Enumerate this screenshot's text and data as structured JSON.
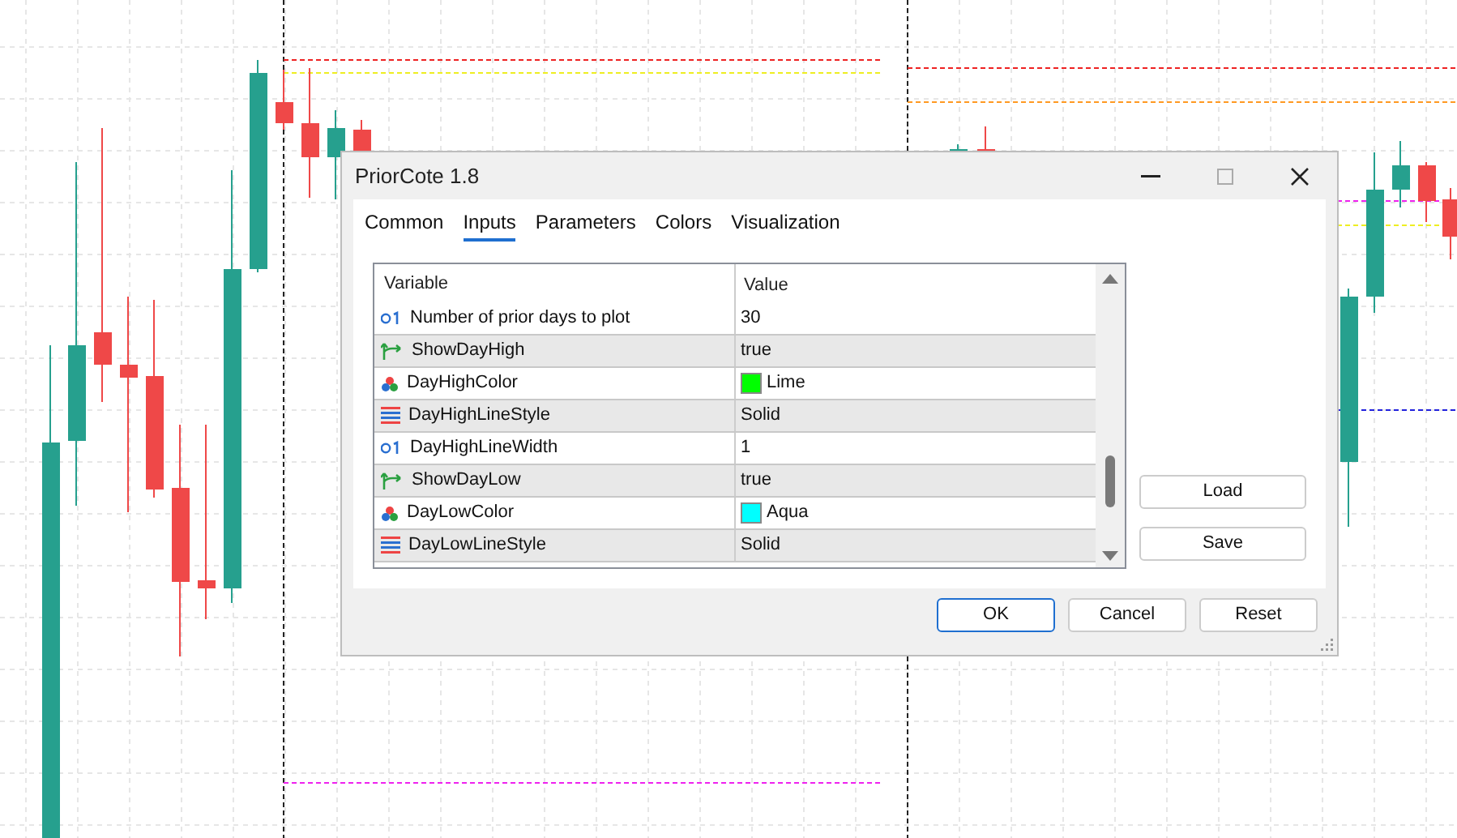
{
  "dialog": {
    "title": "PriorCote 1.8",
    "tabs": [
      {
        "label": "Common",
        "selected": false
      },
      {
        "label": "Inputs",
        "selected": true
      },
      {
        "label": "Parameters",
        "selected": false
      },
      {
        "label": "Colors",
        "selected": false
      },
      {
        "label": "Visualization",
        "selected": false
      }
    ],
    "table": {
      "columns": [
        "Variable",
        "Value"
      ],
      "rows": [
        {
          "kind": "int",
          "variable": "Number of prior days to plot",
          "value": "30"
        },
        {
          "kind": "bool",
          "variable": "ShowDayHigh",
          "value": "true"
        },
        {
          "kind": "color",
          "variable": "DayHighColor",
          "value": "Lime",
          "color": "#00ff00"
        },
        {
          "kind": "style",
          "variable": "DayHighLineStyle",
          "value": "Solid"
        },
        {
          "kind": "int",
          "variable": "DayHighLineWidth",
          "value": "1"
        },
        {
          "kind": "bool",
          "variable": "ShowDayLow",
          "value": "true"
        },
        {
          "kind": "color",
          "variable": "DayLowColor",
          "value": "Aqua",
          "color": "#00ffff"
        },
        {
          "kind": "style",
          "variable": "DayLowLineStyle",
          "value": "Solid"
        }
      ]
    },
    "side_buttons": [
      "Load",
      "Save"
    ],
    "buttons": [
      {
        "label": "OK",
        "default": true
      },
      {
        "label": "Cancel",
        "default": false
      },
      {
        "label": "Reset",
        "default": false
      }
    ]
  }
}
